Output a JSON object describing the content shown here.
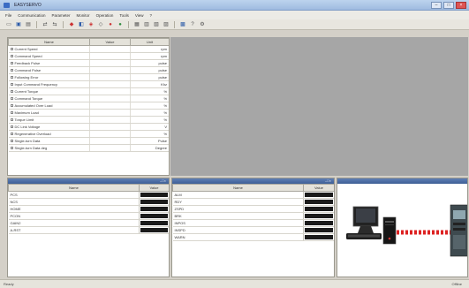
{
  "window": {
    "title": "EASYSERVO"
  },
  "menu": [
    "File",
    "Communication",
    "Parameter",
    "Monitor",
    "Operation",
    "Tools",
    "View",
    "?"
  ],
  "status_table": {
    "headers": {
      "name": "Name",
      "value": "Value",
      "unit": "Unit"
    },
    "rows": [
      {
        "name": "Current Speed",
        "unit": "rpm"
      },
      {
        "name": "Command Speed",
        "unit": "rpm"
      },
      {
        "name": "Feedback Pulse",
        "unit": "pulse"
      },
      {
        "name": "Command Pulse",
        "unit": "pulse"
      },
      {
        "name": "Following Error",
        "unit": "pulse"
      },
      {
        "name": "Input Command Frequency",
        "unit": "Khz"
      },
      {
        "name": "Current Torque",
        "unit": "%"
      },
      {
        "name": "Command Torque",
        "unit": "%"
      },
      {
        "name": "Accumulated Over Load",
        "unit": "%"
      },
      {
        "name": "Maximum Load",
        "unit": "%"
      },
      {
        "name": "Torque Limit",
        "unit": "%"
      },
      {
        "name": "DC Link Voltage",
        "unit": "V"
      },
      {
        "name": "Regenerative Overload",
        "unit": "%"
      },
      {
        "name": "Single-turn Data",
        "unit": "Pulse"
      },
      {
        "name": "Single-turn Data deg",
        "unit": "Degree"
      }
    ]
  },
  "inputs": {
    "headers": {
      "name": "Name",
      "value": "Value"
    },
    "rows": [
      "PCS",
      "NCS",
      "HOME",
      "PCON",
      "GAIN2",
      "A-RST"
    ]
  },
  "outputs": {
    "headers": {
      "name": "Name",
      "value": "Value"
    },
    "rows": [
      "ALM",
      "RDY",
      "ZSPD",
      "BRK",
      "INPOS",
      "INSPD",
      "WARN"
    ]
  },
  "statusbar": {
    "left": "Ready",
    "right": "Offline"
  },
  "colors": {
    "link_dash": "#d22",
    "panel_header": "#4a6aa3"
  }
}
